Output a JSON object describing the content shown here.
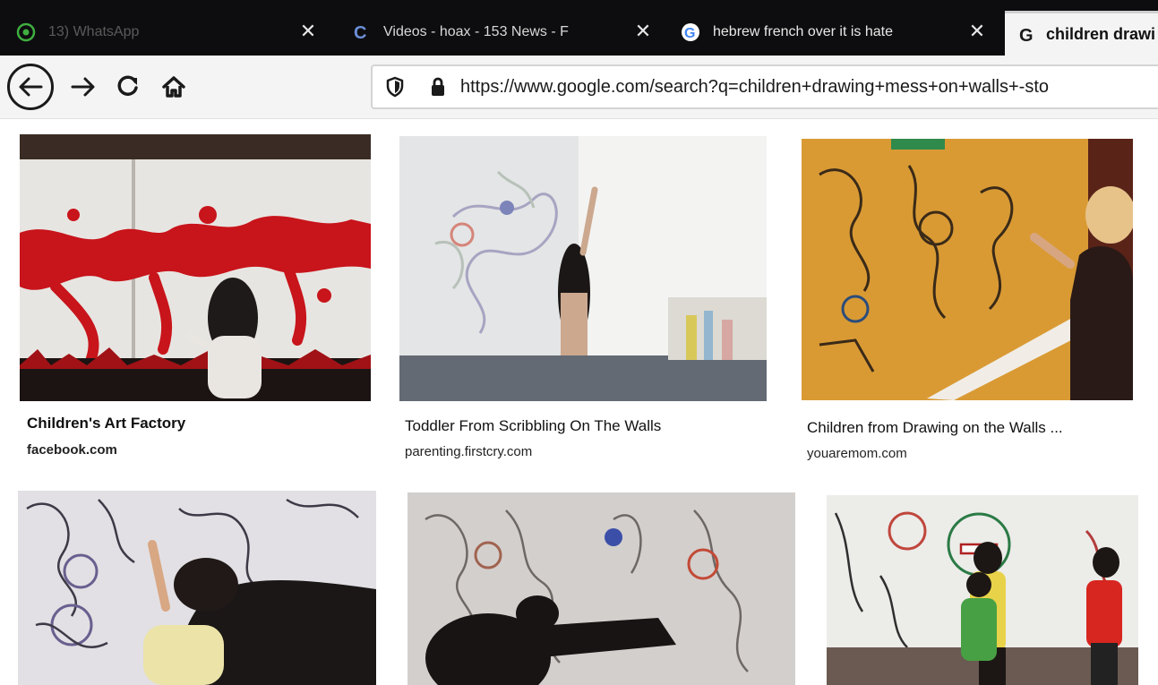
{
  "browser": {
    "tabs": [
      {
        "title": "13) WhatsApp",
        "icon": "whatsapp-icon",
        "close": "✕",
        "active": false
      },
      {
        "title": "Videos - hoax - 153 News - F",
        "icon": "c-logo-icon",
        "close": "✕",
        "active": false
      },
      {
        "title": "hebrew french over it is hate",
        "icon": "google-icon",
        "close": "✕",
        "active": false
      },
      {
        "title": "children drawi",
        "icon": "google-icon",
        "active": true
      }
    ],
    "url": "https://www.google.com/search?q=children+drawing+mess+on+walls+-sto",
    "accent": "#1a1a1a",
    "google_blue": "#4285f4"
  },
  "results": [
    {
      "title": "Children's Art Factory",
      "source": "facebook.com",
      "title_bold": true
    },
    {
      "title": "Toddler From Scribbling On The Walls",
      "source": "parenting.firstcry.com",
      "title_bold": false
    },
    {
      "title": "Children from Drawing on the Walls ...",
      "source": "youaremom.com",
      "title_bold": false
    },
    {
      "title": "",
      "source": ""
    },
    {
      "title": "",
      "source": ""
    },
    {
      "title": "",
      "source": ""
    }
  ]
}
